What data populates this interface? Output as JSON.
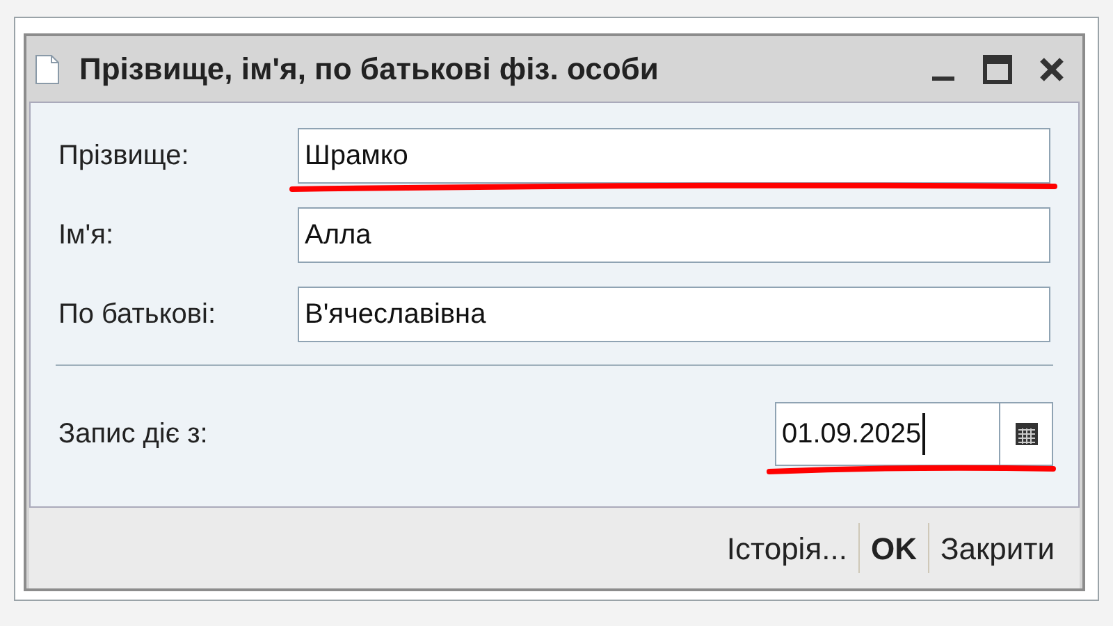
{
  "window": {
    "title": "Прізвище, ім'я, по батькові фіз. особи"
  },
  "fields": [
    {
      "label": "Прізвище:",
      "value": "Шрамко",
      "highlighted": true
    },
    {
      "label": "Ім'я:",
      "value": "Алла",
      "highlighted": false
    },
    {
      "label": "По батькові:",
      "value": "В'ячеславівна",
      "highlighted": false
    }
  ],
  "date": {
    "label": "Запис діє з:",
    "value": "01.09.2025",
    "highlighted": true
  },
  "buttons": [
    {
      "label": "Історія...",
      "kind": "normal"
    },
    {
      "label": "OK",
      "kind": "default"
    },
    {
      "label": "Закрити",
      "kind": "normal"
    }
  ]
}
